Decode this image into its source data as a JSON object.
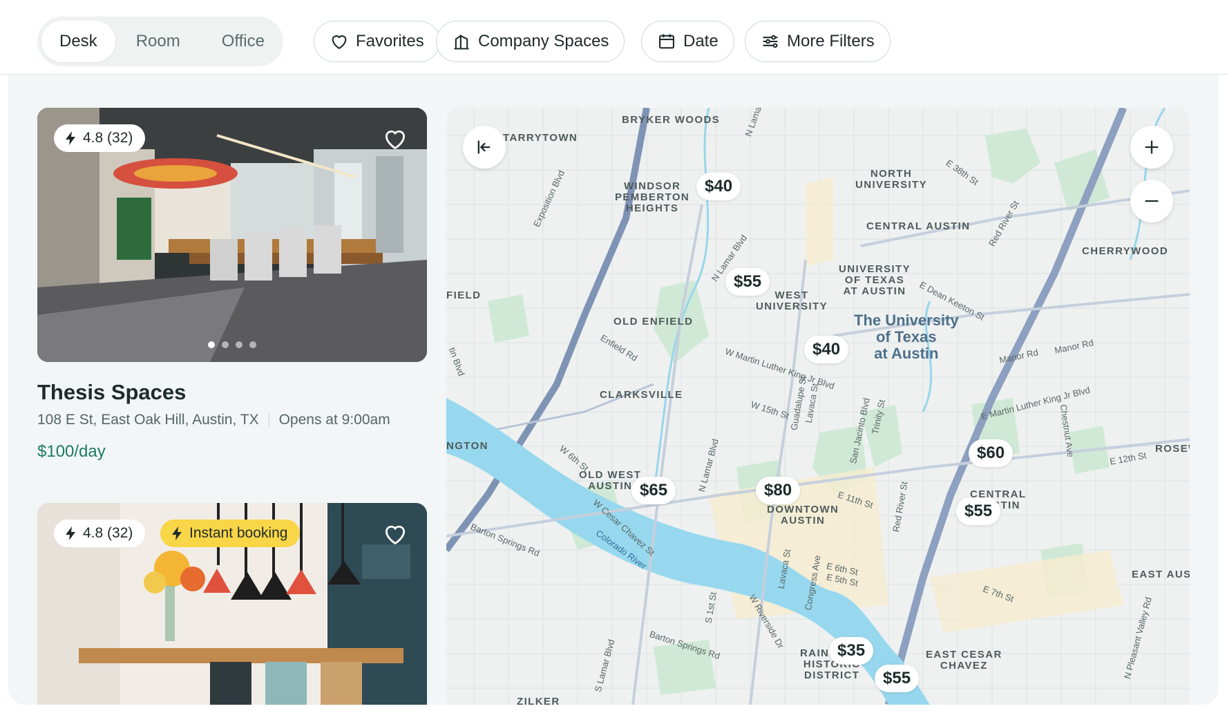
{
  "filters": {
    "space_types": [
      "Desk",
      "Room",
      "Office"
    ],
    "active_type": "Desk",
    "favorites_label": "Favorites",
    "company_spaces_label": "Company Spaces",
    "date_label": "Date",
    "more_filters_label": "More Filters"
  },
  "listings": [
    {
      "rating": "4.8 (32)",
      "title": "Thesis Spaces",
      "address": "108 E St, East Oak Hill, Austin, TX",
      "hours": "Opens at 9:00am",
      "price": "$100/day",
      "photo_count": 4,
      "photo_index": 0
    },
    {
      "rating": "4.8 (32)",
      "badge": "Instant booking"
    }
  ],
  "map": {
    "neighborhoods": [
      "BRYKER WOODS",
      "TARRYTOWN",
      "WINDSOR\nPEMBERTON\nHEIGHTS",
      "NORTH\nUNIVERSITY",
      "CENTRAL AUSTIN",
      "CHERRYWOOD",
      "UNIVERSITY\nOF TEXAS\nAT AUSTIN",
      "WEST\nUNIVERSITY",
      "OLD ENFIELD",
      "CLARKSVILLE",
      "OLD WEST\nAUSTIN",
      "DOWNTOWN\nAUSTIN",
      "CENTRAL\nAUSTIN",
      "FIELD",
      "NGTON",
      "ROSEW",
      "EAST AUS",
      "RAINEY ST\nHISTORIC\nDISTRICT",
      "EAST CESAR\nCHAVEZ",
      "ZILKER"
    ],
    "campus_label": "The University\nof Texas\nat Austin",
    "streets": [
      "Exposition Blvd",
      "N Lamar Blvd",
      "E 38th St",
      "Red River St",
      "E Dean Keeton St",
      "Manor Rd",
      "Manor Rd",
      "Enfield Rd",
      "W Martin Luther King Jr Blvd",
      "Guadalupe St",
      "Lavaca St",
      "W 15th St",
      "San Jacinto Blvd",
      "Trinity St",
      "E Martin Luther King Jr Blvd",
      "Chestnut Ave",
      "E 12th St",
      "W 6th St",
      "N Lamar Blvd",
      "E 11th St",
      "Red River St",
      "W Cesar Chavez St",
      "Colorado River",
      "Barton Springs Rd",
      "Lavaca St",
      "Congress Ave",
      "E 6th St",
      "E 5th St",
      "E 7th St",
      "S 1st St",
      "W Riverside Dr",
      "Barton Springs Rd",
      "S Lamar Blvd",
      "N Pleasant Valley Rd",
      "N Lamar",
      "tin Blvd"
    ],
    "prices": [
      "$40",
      "$55",
      "$40",
      "$60",
      "$65",
      "$80",
      "$55",
      "$35",
      "$55"
    ],
    "controls": {
      "collapse_icon": "collapse-left-icon",
      "zoom_in_icon": "plus-icon",
      "zoom_out_icon": "minus-icon"
    }
  }
}
